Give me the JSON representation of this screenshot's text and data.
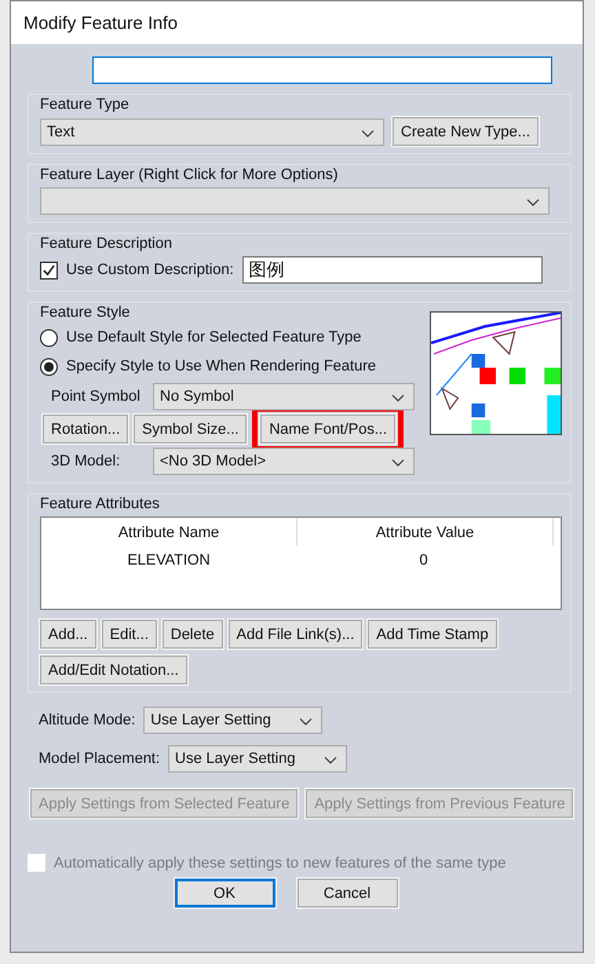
{
  "window": {
    "title": "Modify Feature Info"
  },
  "feature_type": {
    "label": "Feature Type",
    "value": "Text",
    "button": "Create New Type..."
  },
  "feature_layer": {
    "label": "Feature Layer (Right Click for More Options)"
  },
  "feature_description": {
    "label": "Feature Description",
    "checkbox": {
      "label": "Use Custom Description:",
      "checked": true
    },
    "value": "图例"
  },
  "feature_style": {
    "label": "Feature Style",
    "options": [
      {
        "label": "Use Default Style for Selected Feature Type",
        "selected": false
      },
      {
        "label": "Specify Style to Use When Rendering Feature",
        "selected": true
      }
    ],
    "point_symbol": {
      "label": "Point Symbol",
      "value": "No Symbol"
    },
    "buttons": [
      {
        "label": "Rotation...",
        "highlighted": false
      },
      {
        "label": "Symbol Size...",
        "highlighted": false
      },
      {
        "label": "Name Font/Pos...",
        "highlighted": true
      }
    ],
    "model": {
      "label": "3D Model:",
      "value": "<No 3D Model>"
    }
  },
  "feature_attributes": {
    "label": "Feature Attributes",
    "columns": [
      "Attribute Name",
      "Attribute Value"
    ],
    "rows": [
      [
        "ELEVATION",
        "0"
      ]
    ],
    "buttons": [
      "Add...",
      "Edit...",
      "Delete",
      "Add File Link(s)...",
      "Add Time Stamp",
      "Add/Edit Notation..."
    ]
  },
  "altitude_mode": {
    "label": "Altitude Mode:",
    "value": "Use Layer Setting"
  },
  "model_placement": {
    "label": "Model Placement:",
    "value": "Use Layer Setting"
  },
  "apply_buttons": [
    {
      "label": "Apply Settings from Selected Feature",
      "disabled": true
    },
    {
      "label": "Apply Settings from Previous Feature",
      "disabled": true
    }
  ],
  "auto_apply": {
    "label": "Automatically apply these settings to new features of the same type",
    "checked": false,
    "disabled": true
  },
  "buttons": [
    {
      "label": "OK",
      "default": true
    },
    {
      "label": "Cancel",
      "default": false
    }
  ]
}
